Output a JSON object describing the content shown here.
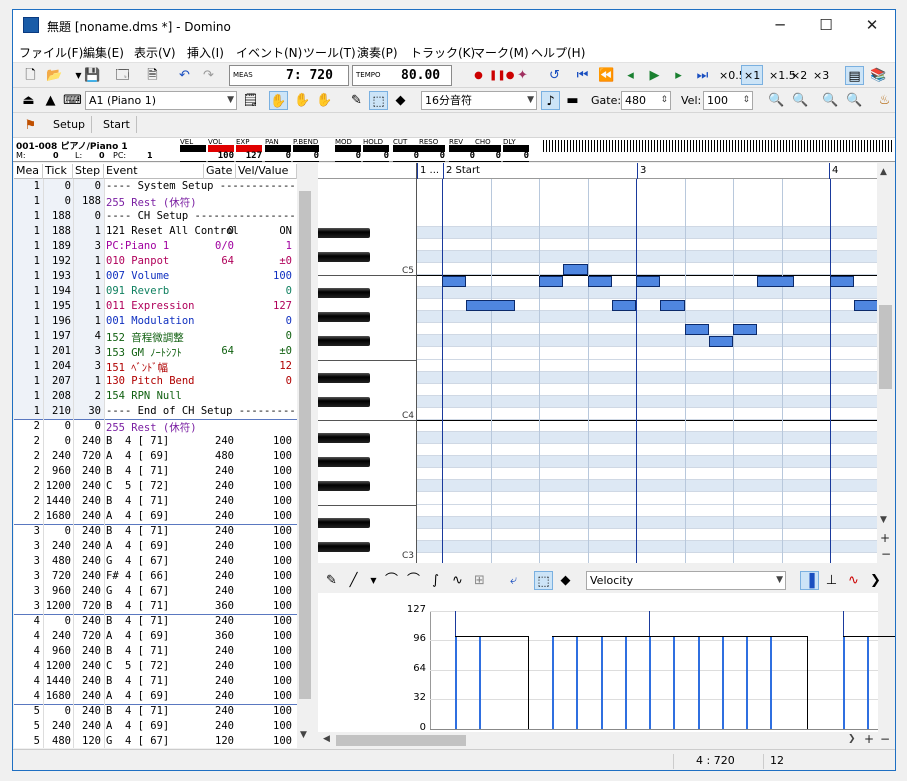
{
  "window": {
    "title": "無題 [noname.dms *] - Domino",
    "minimize": "─",
    "maximize": "☐",
    "close": "✕"
  },
  "menu": [
    "ファイル(F)",
    "編集(E)",
    "表示(V)",
    "挿入(I)",
    "イベント(N)",
    "ツール(T)",
    "演奏(P)",
    "トラック(K)",
    "マーク(M)",
    "ヘルプ(H)"
  ],
  "toolbar1": {
    "meas_label": "MEAS",
    "meas_value": "7: 720",
    "tempo_label": "TEMPO",
    "tempo_value": "80.00",
    "speeds": [
      "×0.5",
      "×1",
      "×1.5",
      "×2",
      "×3"
    ]
  },
  "toolbar2": {
    "track": "A1 (Piano 1)",
    "note_length": "16分音符",
    "gate_label": "Gate:",
    "gate_value": "480",
    "vel_label": "Vel:",
    "vel_value": "100"
  },
  "toolbar3": {
    "setup": "Setup",
    "start": "Start"
  },
  "trackinfo": {
    "line1": "001-008 ピアノ/Piano 1",
    "m_label": "M:",
    "m_value": "0",
    "l_label": "L:",
    "l_value": "0",
    "pc_label": "PC:",
    "pc_value": "1"
  },
  "controllers": [
    {
      "label": "VEL",
      "value": ""
    },
    {
      "label": "VOL",
      "value": "100"
    },
    {
      "label": "EXP",
      "value": "127"
    },
    {
      "label": "PAN",
      "value": "0"
    },
    {
      "label": "P.BEND",
      "value": "0"
    },
    {
      "label": "MOD",
      "value": "0"
    },
    {
      "label": "HOLD",
      "value": "0"
    },
    {
      "label": "CUT",
      "value": "0"
    },
    {
      "label": "RESO",
      "value": "0"
    },
    {
      "label": "REV",
      "value": "0"
    },
    {
      "label": "CHO",
      "value": "0"
    },
    {
      "label": "DLY",
      "value": "0"
    }
  ],
  "event_headers": [
    "Mea",
    "Tick",
    "Step",
    "Event",
    "Gate",
    "Vel/Value"
  ],
  "events": [
    {
      "mea": "1",
      "tick": "0",
      "step": "0",
      "event": "---- System Setup -------------",
      "gate": "",
      "val": "",
      "color": "#000"
    },
    {
      "mea": "1",
      "tick": "0",
      "step": "188",
      "event": "255 Rest (休符)",
      "gate": "",
      "val": "",
      "color": "#7a1fa2"
    },
    {
      "mea": "1",
      "tick": "188",
      "step": "0",
      "event": "---- CH Setup -----------------",
      "gate": "",
      "val": "",
      "color": "#000"
    },
    {
      "mea": "1",
      "tick": "188",
      "step": "1",
      "event": "121 Reset All Control",
      "gate": "0",
      "val": "ON",
      "color": "#000"
    },
    {
      "mea": "1",
      "tick": "189",
      "step": "3",
      "event": "PC:Piano 1",
      "gate": "0/0",
      "val": "1",
      "color": "#a000a0"
    },
    {
      "mea": "1",
      "tick": "192",
      "step": "1",
      "event": "010 Panpot",
      "gate": "64",
      "val": "±0",
      "color": "#b0005a"
    },
    {
      "mea": "1",
      "tick": "193",
      "step": "1",
      "event": "007 Volume",
      "gate": "",
      "val": "100",
      "color": "#1030c0"
    },
    {
      "mea": "1",
      "tick": "194",
      "step": "1",
      "event": "091 Reverb",
      "gate": "",
      "val": "0",
      "color": "#108060"
    },
    {
      "mea": "1",
      "tick": "195",
      "step": "1",
      "event": "011 Expression",
      "gate": "",
      "val": "127",
      "color": "#b0005a"
    },
    {
      "mea": "1",
      "tick": "196",
      "step": "1",
      "event": "001 Modulation",
      "gate": "",
      "val": "0",
      "color": "#1030c0"
    },
    {
      "mea": "1",
      "tick": "197",
      "step": "4",
      "event": "152 音程微調整",
      "gate": "",
      "val": "0",
      "color": "#106010"
    },
    {
      "mea": "1",
      "tick": "201",
      "step": "3",
      "event": "153 GM ﾉｰﾄｼﾌﾄ",
      "gate": "64",
      "val": "±0",
      "color": "#106010"
    },
    {
      "mea": "1",
      "tick": "204",
      "step": "3",
      "event": "151 ﾍﾞﾝﾄﾞ幅",
      "gate": "",
      "val": "12",
      "color": "#b00000"
    },
    {
      "mea": "1",
      "tick": "207",
      "step": "1",
      "event": "130 Pitch Bend",
      "gate": "",
      "val": "0",
      "color": "#b00000"
    },
    {
      "mea": "1",
      "tick": "208",
      "step": "2",
      "event": "154 RPN Null",
      "gate": "",
      "val": "",
      "color": "#106010"
    },
    {
      "mea": "1",
      "tick": "210",
      "step": "30",
      "event": "---- End of CH Setup ----------",
      "gate": "",
      "val": "",
      "color": "#000"
    },
    {
      "mea": "2",
      "tick": "0",
      "step": "0",
      "event": "255 Rest (休符)",
      "gate": "",
      "val": "",
      "color": "#7a1fa2"
    },
    {
      "mea": "2",
      "tick": "0",
      "step": "240",
      "event": "B  4 [ 71]",
      "gate": "240",
      "val": "100",
      "color": "#000"
    },
    {
      "mea": "2",
      "tick": "240",
      "step": "720",
      "event": "A  4 [ 69]",
      "gate": "480",
      "val": "100",
      "color": "#000"
    },
    {
      "mea": "2",
      "tick": "960",
      "step": "240",
      "event": "B  4 [ 71]",
      "gate": "240",
      "val": "100",
      "color": "#000"
    },
    {
      "mea": "2",
      "tick": "1200",
      "step": "240",
      "event": "C  5 [ 72]",
      "gate": "240",
      "val": "100",
      "color": "#000"
    },
    {
      "mea": "2",
      "tick": "1440",
      "step": "240",
      "event": "B  4 [ 71]",
      "gate": "240",
      "val": "100",
      "color": "#000"
    },
    {
      "mea": "2",
      "tick": "1680",
      "step": "240",
      "event": "A  4 [ 69]",
      "gate": "240",
      "val": "100",
      "color": "#000"
    },
    {
      "mea": "3",
      "tick": "0",
      "step": "240",
      "event": "B  4 [ 71]",
      "gate": "240",
      "val": "100",
      "color": "#000"
    },
    {
      "mea": "3",
      "tick": "240",
      "step": "240",
      "event": "A  4 [ 69]",
      "gate": "240",
      "val": "100",
      "color": "#000"
    },
    {
      "mea": "3",
      "tick": "480",
      "step": "240",
      "event": "G  4 [ 67]",
      "gate": "240",
      "val": "100",
      "color": "#000"
    },
    {
      "mea": "3",
      "tick": "720",
      "step": "240",
      "event": "F# 4 [ 66]",
      "gate": "240",
      "val": "100",
      "color": "#000"
    },
    {
      "mea": "3",
      "tick": "960",
      "step": "240",
      "event": "G  4 [ 67]",
      "gate": "240",
      "val": "100",
      "color": "#000"
    },
    {
      "mea": "3",
      "tick": "1200",
      "step": "720",
      "event": "B  4 [ 71]",
      "gate": "360",
      "val": "100",
      "color": "#000"
    },
    {
      "mea": "4",
      "tick": "0",
      "step": "240",
      "event": "B  4 [ 71]",
      "gate": "240",
      "val": "100",
      "color": "#000"
    },
    {
      "mea": "4",
      "tick": "240",
      "step": "720",
      "event": "A  4 [ 69]",
      "gate": "360",
      "val": "100",
      "color": "#000"
    },
    {
      "mea": "4",
      "tick": "960",
      "step": "240",
      "event": "B  4 [ 71]",
      "gate": "240",
      "val": "100",
      "color": "#000"
    },
    {
      "mea": "4",
      "tick": "1200",
      "step": "240",
      "event": "C  5 [ 72]",
      "gate": "240",
      "val": "100",
      "color": "#000"
    },
    {
      "mea": "4",
      "tick": "1440",
      "step": "240",
      "event": "B  4 [ 71]",
      "gate": "240",
      "val": "100",
      "color": "#000"
    },
    {
      "mea": "4",
      "tick": "1680",
      "step": "240",
      "event": "A  4 [ 69]",
      "gate": "240",
      "val": "100",
      "color": "#000"
    },
    {
      "mea": "5",
      "tick": "0",
      "step": "240",
      "event": "B  4 [ 71]",
      "gate": "240",
      "val": "100",
      "color": "#000"
    },
    {
      "mea": "5",
      "tick": "240",
      "step": "240",
      "event": "A  4 [ 69]",
      "gate": "240",
      "val": "100",
      "color": "#000"
    },
    {
      "mea": "5",
      "tick": "480",
      "step": "120",
      "event": "G  4 [ 67]",
      "gate": "120",
      "val": "100",
      "color": "#000"
    }
  ],
  "roll": {
    "measures": [
      {
        "label": "1",
        "text": "1 ..."
      },
      {
        "label": "2",
        "text": "2 Start"
      },
      {
        "label": "3",
        "text": "3"
      },
      {
        "label": "4",
        "text": "4"
      }
    ],
    "octave_labels": [
      "C5",
      "C4",
      "C3"
    ]
  },
  "velocity": {
    "select": "Velocity",
    "ticks": [
      "127",
      "96",
      "64",
      "32",
      "0"
    ]
  },
  "status": {
    "position": "4 : 720",
    "value": "12"
  }
}
